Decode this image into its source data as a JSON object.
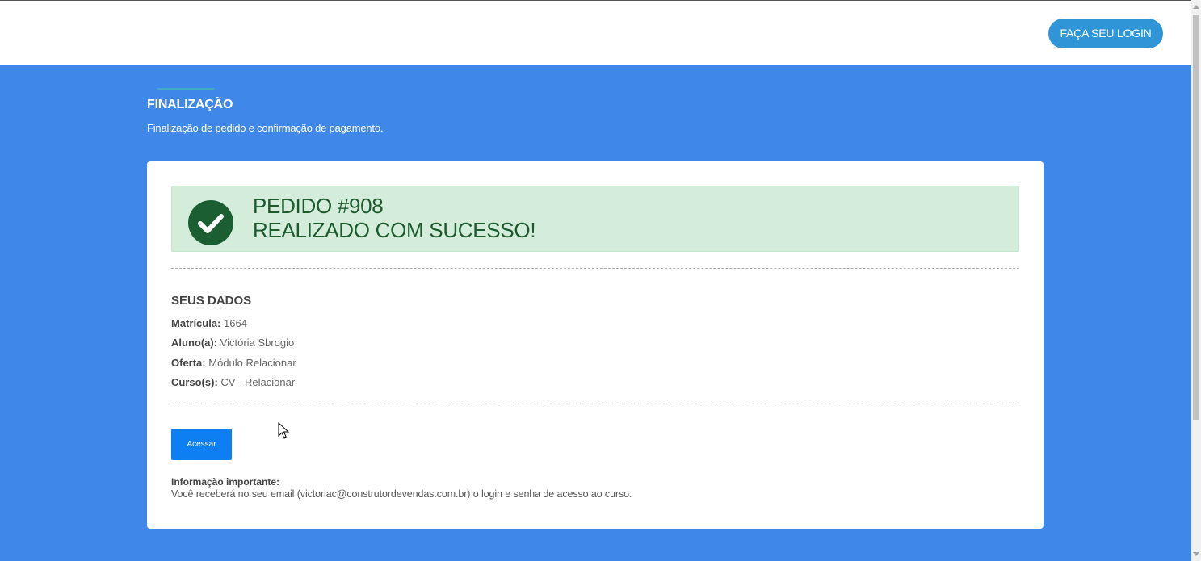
{
  "header": {
    "login_label": "FAÇA SEU LOGIN"
  },
  "page": {
    "title": "FINALIZAÇÃO",
    "subtitle": "Finalização de pedido e confirmação de pagamento."
  },
  "alert": {
    "line1": "PEDIDO #908",
    "line2": "REALIZADO COM SUCESSO!",
    "icon": "check-circle-icon",
    "color": "#1a5e32",
    "background": "#d4eddb"
  },
  "data": {
    "title": "SEUS DADOS",
    "rows": [
      {
        "label": "Matrícula:",
        "value": "1664"
      },
      {
        "label": "Aluno(a):",
        "value": "Victória Sbrogio"
      },
      {
        "label": "Oferta:",
        "value": "Módulo Relacionar"
      },
      {
        "label": "Curso(s):",
        "value": "CV - Relacionar"
      }
    ]
  },
  "actions": {
    "acessar_label": "Acessar"
  },
  "info": {
    "title": "Informação importante:",
    "text": "Você receberá no seu email (victoriac@construtordevendas.com.br) o login e senha de acesso ao curso."
  },
  "colors": {
    "hero": "#3f87e8",
    "login_button": "#2f95d6",
    "acessar_button": "#0d7ff2"
  }
}
